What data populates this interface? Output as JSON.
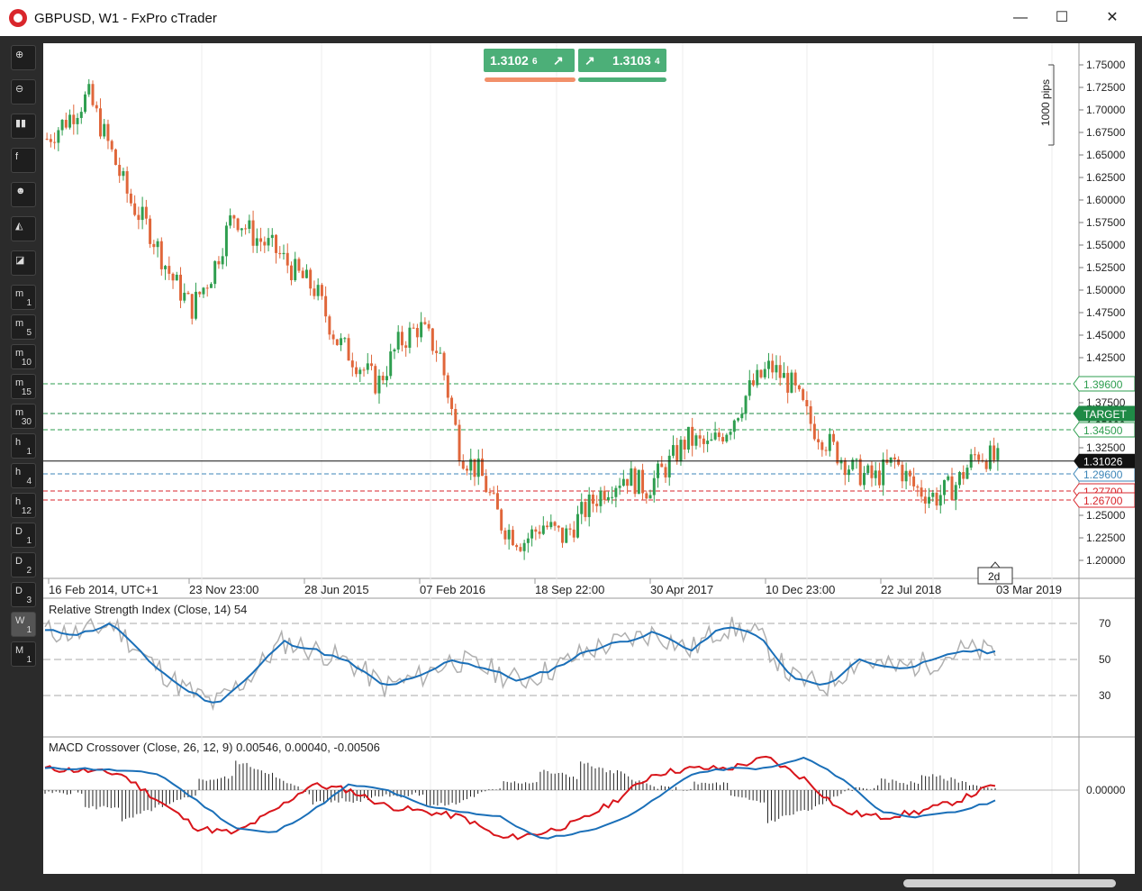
{
  "window": {
    "title": "GBPUSD, W1 - FxPro cTrader",
    "minimize": "—",
    "maximize": "☐",
    "close": "✕"
  },
  "colors": {
    "up": "#2e9e4f",
    "down": "#e0663a",
    "rsi_raw": "#b0b0b0",
    "rsi_ma": "#1a6fb8",
    "macd": "#d8151b",
    "signal": "#1a6fb8"
  },
  "toolbar": [
    {
      "name": "zoom-in-icon",
      "a": "⊕",
      "b": ""
    },
    {
      "name": "zoom-out-icon",
      "a": "⊖",
      "b": ""
    },
    {
      "name": "candles-icon",
      "a": "▮▮",
      "b": ""
    },
    {
      "name": "facebook-icon",
      "a": "f",
      "b": ""
    },
    {
      "name": "robot-icon",
      "a": "☻",
      "b": ""
    },
    {
      "name": "chart-style-icon",
      "a": "◭",
      "b": ""
    },
    {
      "name": "indicators-icon",
      "a": "◪",
      "b": ""
    },
    {
      "name": "tf-m1",
      "a": "m",
      "b": "1"
    },
    {
      "name": "tf-m5",
      "a": "m",
      "b": "5"
    },
    {
      "name": "tf-m10",
      "a": "m",
      "b": "10"
    },
    {
      "name": "tf-m15",
      "a": "m",
      "b": "15"
    },
    {
      "name": "tf-m30",
      "a": "m",
      "b": "30"
    },
    {
      "name": "tf-h1",
      "a": "h",
      "b": "1"
    },
    {
      "name": "tf-h4",
      "a": "h",
      "b": "4"
    },
    {
      "name": "tf-h12",
      "a": "h",
      "b": "12"
    },
    {
      "name": "tf-d1",
      "a": "D",
      "b": "1"
    },
    {
      "name": "tf-d2",
      "a": "D",
      "b": "2"
    },
    {
      "name": "tf-d3",
      "a": "D",
      "b": "3"
    },
    {
      "name": "tf-w1",
      "a": "W",
      "b": "1"
    },
    {
      "name": "tf-M1",
      "a": "M",
      "b": "1"
    }
  ],
  "quote": {
    "bid": "1.3102",
    "bid_pip": "6",
    "ask": "1.3103",
    "ask_pip": "4",
    "bid_arrow": "↗",
    "ask_arrow": "↗"
  },
  "pips_label": "1000 pips",
  "price_axis": [
    "1.75000",
    "1.72500",
    "1.70000",
    "1.67500",
    "1.65000",
    "1.62500",
    "1.60000",
    "1.57500",
    "1.55000",
    "1.52500",
    "1.50000",
    "1.47500",
    "1.45000",
    "1.42500",
    "1.40000",
    "1.37500",
    "1.35000",
    "1.32500",
    "1.30000",
    "1.27500",
    "1.25000",
    "1.22500",
    "1.20000"
  ],
  "levels": [
    {
      "price": "1.39600",
      "label": "1.39600",
      "color": "#2e9e4f"
    },
    {
      "price": "1.36300",
      "label": "TARGET",
      "color": "#1f8a46"
    },
    {
      "price": "1.34500",
      "label": "1.34500",
      "color": "#2e9e4f"
    },
    {
      "price": "1.29600",
      "label": "1.29600",
      "color": "#3d86b8"
    },
    {
      "price": "1.27700",
      "label": "1.27700",
      "color": "#d8262c"
    },
    {
      "price": "1.26700",
      "label": "1.26700",
      "color": "#d8262c"
    }
  ],
  "current_price": "1.31026",
  "countdown": "2d",
  "time_axis": [
    "16 Feb 2014, UTC+1",
    "23 Nov 23:00",
    "28 Jun 2015",
    "07 Feb 2016",
    "18 Sep 22:00",
    "30 Apr 2017",
    "10 Dec 23:00",
    "22 Jul 2018",
    "03 Mar 2019"
  ],
  "rsi": {
    "label": "Relative Strength Index (Close, 14) 54",
    "levels": [
      "70",
      "50",
      "30"
    ]
  },
  "macd": {
    "label": "MACD Crossover (Close, 26, 12, 9) 0.00546, 0.00040, -0.00506",
    "zero": "0.00000"
  },
  "chart_data": {
    "type": "candlestick",
    "symbol": "GBPUSD",
    "timeframe": "W1",
    "x": [
      "16 Feb 2014",
      "23 Nov 2014",
      "28 Jun 2015",
      "07 Feb 2016",
      "18 Sep 2016",
      "30 Apr 2017",
      "10 Dec 2017",
      "22 Jul 2018",
      "03 Mar 2019"
    ],
    "close_path": [
      1.668,
      1.69,
      1.716,
      1.66,
      1.6,
      1.565,
      1.515,
      1.48,
      1.52,
      1.585,
      1.56,
      1.545,
      1.52,
      1.5,
      1.445,
      1.42,
      1.395,
      1.44,
      1.46,
      1.43,
      1.32,
      1.295,
      1.24,
      1.22,
      1.24,
      1.225,
      1.255,
      1.28,
      1.295,
      1.28,
      1.305,
      1.335,
      1.325,
      1.35,
      1.39,
      1.415,
      1.395,
      1.35,
      1.325,
      1.3,
      1.29,
      1.31,
      1.28,
      1.27,
      1.285,
      1.32,
      1.31
    ],
    "ylim": [
      1.19,
      1.76
    ],
    "current": 1.31026,
    "rsi_ylim": [
      10,
      90
    ],
    "rsi_path": [
      66,
      64,
      70,
      50,
      35,
      25,
      40,
      60,
      55,
      48,
      35,
      40,
      50,
      45,
      38,
      45,
      55,
      60,
      65,
      55,
      68,
      64,
      40,
      35,
      50,
      45,
      48,
      55,
      54
    ],
    "macd_path": [
      0.02,
      0.018,
      0.015,
      -0.01,
      -0.035,
      -0.04,
      -0.02,
      0.005,
      0.0,
      -0.015,
      -0.02,
      -0.025,
      -0.045,
      -0.04,
      -0.03,
      -0.01,
      0.015,
      0.02,
      0.02,
      0.03,
      0.01,
      -0.02,
      -0.025,
      -0.02,
      -0.01,
      0.005
    ]
  }
}
